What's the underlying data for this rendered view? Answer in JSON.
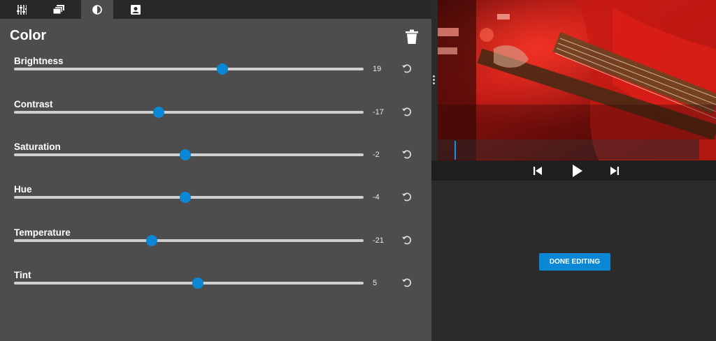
{
  "tabs": [
    {
      "icon": "sliders-icon",
      "active": false
    },
    {
      "icon": "layers-icon",
      "active": false
    },
    {
      "icon": "contrast-icon",
      "active": true
    },
    {
      "icon": "portrait-icon",
      "active": false
    }
  ],
  "panel": {
    "title": "Color",
    "delete_icon": "trash-icon"
  },
  "adjustments": [
    {
      "label": "Brightness",
      "value": "19",
      "level": 0.596
    },
    {
      "label": "Contrast",
      "value": "-17",
      "level": 0.414
    },
    {
      "label": "Saturation",
      "value": "-2",
      "level": 0.49
    },
    {
      "label": "Hue",
      "value": "-4",
      "level": 0.49
    },
    {
      "label": "Temperature",
      "value": "-21",
      "level": 0.394
    },
    {
      "label": "Tint",
      "value": "5",
      "level": 0.526
    }
  ],
  "player": {
    "playhead_position": 0.065,
    "prev_icon": "skip-previous-icon",
    "play_icon": "play-icon",
    "next_icon": "skip-next-icon"
  },
  "actions": {
    "done_label": "DONE EDITING"
  },
  "colors": {
    "accent": "#0a88d6",
    "panel_bg": "#4d4d4d",
    "app_bg": "#2b2b2b"
  }
}
